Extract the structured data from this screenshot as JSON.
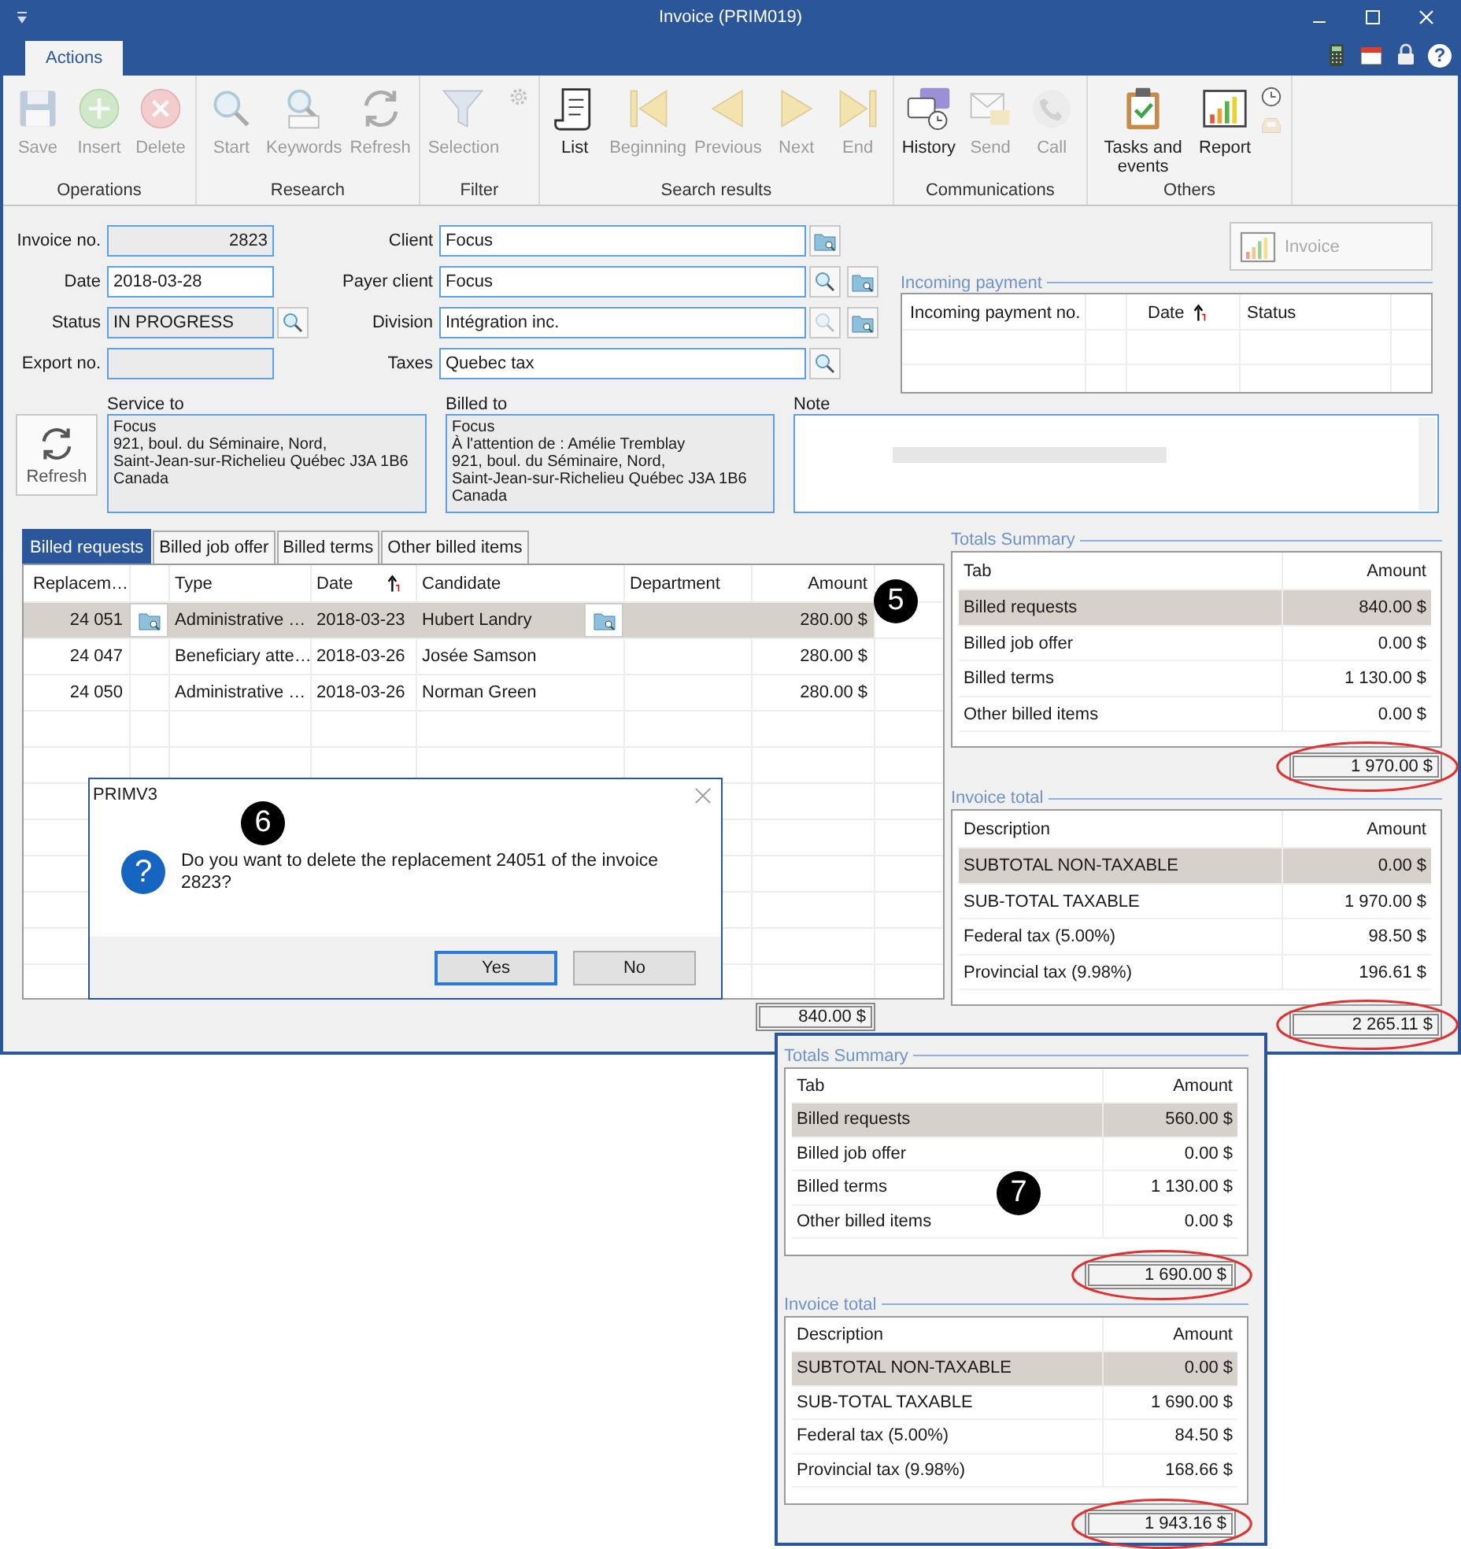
{
  "window": {
    "title": "Invoice (PRIM019)"
  },
  "ribbon": {
    "tabs": [
      {
        "label": "Actions",
        "selected": true
      }
    ],
    "help": {
      "label": "?"
    },
    "groups": [
      {
        "label": "Operations",
        "buttons": [
          {
            "kind": "large",
            "label": "Save",
            "disabled": true
          },
          {
            "kind": "large",
            "label": "Insert",
            "disabled": true
          },
          {
            "kind": "large",
            "label": "Delete",
            "disabled": true
          }
        ]
      },
      {
        "label": "Research",
        "buttons": [
          {
            "kind": "large",
            "label": "Start",
            "disabled": true
          },
          {
            "kind": "large",
            "label": "Keywords",
            "disabled": true
          },
          {
            "kind": "large",
            "label": "Refresh",
            "disabled": true
          }
        ]
      },
      {
        "label": "Filter",
        "buttons": [
          {
            "kind": "large",
            "label": "Selection",
            "disabled": true
          },
          {
            "kind": "small",
            "disabled": true
          }
        ]
      },
      {
        "label": "Search results",
        "buttons": [
          {
            "kind": "large",
            "label": "List",
            "disabled": false
          },
          {
            "kind": "large",
            "label": "Beginning",
            "disabled": true
          },
          {
            "kind": "large",
            "label": "Previous",
            "disabled": true
          },
          {
            "kind": "large",
            "label": "Next",
            "disabled": true
          },
          {
            "kind": "large",
            "label": "End",
            "disabled": true
          }
        ]
      },
      {
        "label": "Communications",
        "buttons": [
          {
            "kind": "large",
            "label": "History",
            "disabled": false
          },
          {
            "kind": "large",
            "label": "Send",
            "disabled": true
          },
          {
            "kind": "large",
            "label": "Call",
            "disabled": true
          }
        ]
      },
      {
        "label": "Others",
        "buttons": [
          {
            "kind": "large",
            "label": "Tasks and events",
            "disabled": false
          },
          {
            "kind": "large",
            "label": "Report",
            "disabled": false
          },
          {
            "kind": "small",
            "disabled": false
          },
          {
            "kind": "small",
            "disabled": true
          }
        ]
      }
    ]
  },
  "form": {
    "left": [
      {
        "label": "Invoice no.",
        "value": "2823",
        "kind": "number",
        "editable": false
      },
      {
        "label": "Date",
        "value": "2018-03-28",
        "kind": "text",
        "editable": true
      },
      {
        "label": "Status",
        "value": "IN PROGRESS",
        "kind": "text",
        "editable": false,
        "buttons": [
          {
            "kind": "search",
            "disabled": false
          }
        ]
      },
      {
        "label": "Export no.",
        "kind": "text",
        "editable": false
      }
    ],
    "right": [
      {
        "label": "Client",
        "value": "Focus",
        "kind": "text",
        "editable": true,
        "buttons": [
          {
            "kind": "folder",
            "disabled": false
          }
        ]
      },
      {
        "label": "Payer client",
        "value": "Focus",
        "kind": "text",
        "editable": true,
        "buttons": [
          {
            "kind": "search",
            "disabled": false
          },
          {
            "kind": "folder",
            "disabled": false
          }
        ]
      },
      {
        "label": "Division",
        "value": "Intégration inc.",
        "kind": "text",
        "editable": true,
        "buttons": [
          {
            "kind": "search",
            "disabled": true
          },
          {
            "kind": "folder",
            "disabled": false
          }
        ]
      },
      {
        "label": "Taxes",
        "value": "Quebec tax",
        "kind": "text",
        "editable": true,
        "buttons": [
          {
            "kind": "search",
            "disabled": false
          }
        ]
      }
    ]
  },
  "invoice_button": {
    "label": "Invoice",
    "disabled": true
  },
  "incoming_payment": {
    "title": "Incoming payment",
    "columns": [
      {
        "label": "Incoming payment no.",
        "sorted": false
      },
      {
        "sorted": false
      },
      {
        "label": "Date",
        "sorted": true
      },
      {
        "label": "Status",
        "sorted": false
      },
      {
        "sorted": false
      }
    ]
  },
  "refresh_button": {
    "label": "Refresh"
  },
  "service_to": {
    "label": "Service to",
    "lines": [
      "Focus",
      "921, boul. du Séminaire, Nord,",
      "Saint-Jean-sur-Richelieu Québec J3A 1B6",
      "Canada"
    ]
  },
  "billed_to": {
    "label": "Billed to",
    "lines": [
      "Focus",
      "À l'attention de : Amélie Tremblay",
      "921, boul. du Séminaire, Nord,",
      "Saint-Jean-sur-Richelieu Québec J3A 1B6",
      "Canada"
    ]
  },
  "note": {
    "label": "Note",
    "blurred_text": true
  },
  "detail_tabs": [
    {
      "label": "Billed requests",
      "selected": true
    },
    {
      "label": "Billed job offer",
      "selected": false
    },
    {
      "label": "Billed terms",
      "selected": false
    },
    {
      "label": "Other billed items",
      "selected": false
    }
  ],
  "table": {
    "callout": "5",
    "columns": [
      {
        "label": "Replacem…",
        "sorted": false
      },
      {
        "sorted": false
      },
      {
        "label": "Type",
        "sorted": false
      },
      {
        "label": "Date",
        "sorted": true
      },
      {
        "label": "Candidate",
        "sorted": false
      },
      {
        "label": "Department",
        "sorted": false
      },
      {
        "label": "Amount",
        "sorted": false
      }
    ],
    "rows": [
      {
        "replacement": "24 051",
        "type": "Administrative …",
        "date": "2018-03-23",
        "candidate": "Hubert Landry",
        "amount": "280.00 $",
        "links": true,
        "selected": true
      },
      {
        "replacement": "24 047",
        "type": "Beneficiary atte…",
        "date": "2018-03-26",
        "candidate": "Josée Samson",
        "amount": "280.00 $",
        "links": false,
        "selected": false
      },
      {
        "replacement": "24 050",
        "type": "Administrative …",
        "date": "2018-03-26",
        "candidate": "Norman Green",
        "amount": "280.00 $",
        "links": false,
        "selected": false
      }
    ],
    "total": "840.00 $"
  },
  "dialog": {
    "title": "PRIMV3",
    "callout": "6",
    "icon_glyph": "?",
    "message": "Do you want to delete the replacement 24051 of the invoice 2823?",
    "buttons": [
      {
        "label": "Yes",
        "default": true
      },
      {
        "label": "No",
        "default": false
      }
    ]
  },
  "totals": {
    "summary": {
      "title": "Totals Summary",
      "columns": [
        "Tab",
        "Amount"
      ],
      "rows": [
        {
          "label": "Billed requests",
          "amount": "840.00 $",
          "selected": true
        },
        {
          "label": "Billed job offer",
          "amount": "0.00 $",
          "selected": false
        },
        {
          "label": "Billed terms",
          "amount": "1 130.00 $",
          "selected": false
        },
        {
          "label": "Other billed items",
          "amount": "0.00 $",
          "selected": false
        }
      ],
      "total": {
        "value": "1 970.00 $",
        "circled": true
      }
    },
    "invoice_total": {
      "title": "Invoice total",
      "columns": [
        "Description",
        "Amount"
      ],
      "rows": [
        {
          "label": "SUBTOTAL NON-TAXABLE",
          "amount": "0.00 $",
          "selected": true
        },
        {
          "label": "SUB-TOTAL TAXABLE",
          "amount": "1 970.00 $",
          "selected": false
        },
        {
          "label": "Federal tax (5.00%)",
          "amount": "98.50 $",
          "selected": false
        },
        {
          "label": "Provincial tax (9.98%)",
          "amount": "196.61 $",
          "selected": false
        }
      ],
      "total": {
        "value": "2 265.11 $",
        "circled": true
      }
    }
  },
  "inset": {
    "callout": "7",
    "summary": {
      "title": "Totals Summary",
      "columns": [
        "Tab",
        "Amount"
      ],
      "rows": [
        {
          "label": "Billed requests",
          "amount": "560.00 $",
          "selected": true
        },
        {
          "label": "Billed job offer",
          "amount": "0.00 $",
          "selected": false
        },
        {
          "label": "Billed terms",
          "amount": "1 130.00 $",
          "selected": false
        },
        {
          "label": "Other billed items",
          "amount": "0.00 $",
          "selected": false
        }
      ],
      "total": {
        "value": "1 690.00 $",
        "circled": true
      }
    },
    "invoice_total": {
      "title": "Invoice total",
      "columns": [
        "Description",
        "Amount"
      ],
      "rows": [
        {
          "label": "SUBTOTAL NON-TAXABLE",
          "amount": "0.00 $",
          "selected": true
        },
        {
          "label": "SUB-TOTAL TAXABLE",
          "amount": "1 690.00 $",
          "selected": false
        },
        {
          "label": "Federal tax (5.00%)",
          "amount": "84.50 $",
          "selected": false
        },
        {
          "label": "Provincial tax (9.98%)",
          "amount": "168.66 $",
          "selected": false
        }
      ],
      "total": {
        "value": "1 943.16 $",
        "circled": true
      }
    }
  }
}
